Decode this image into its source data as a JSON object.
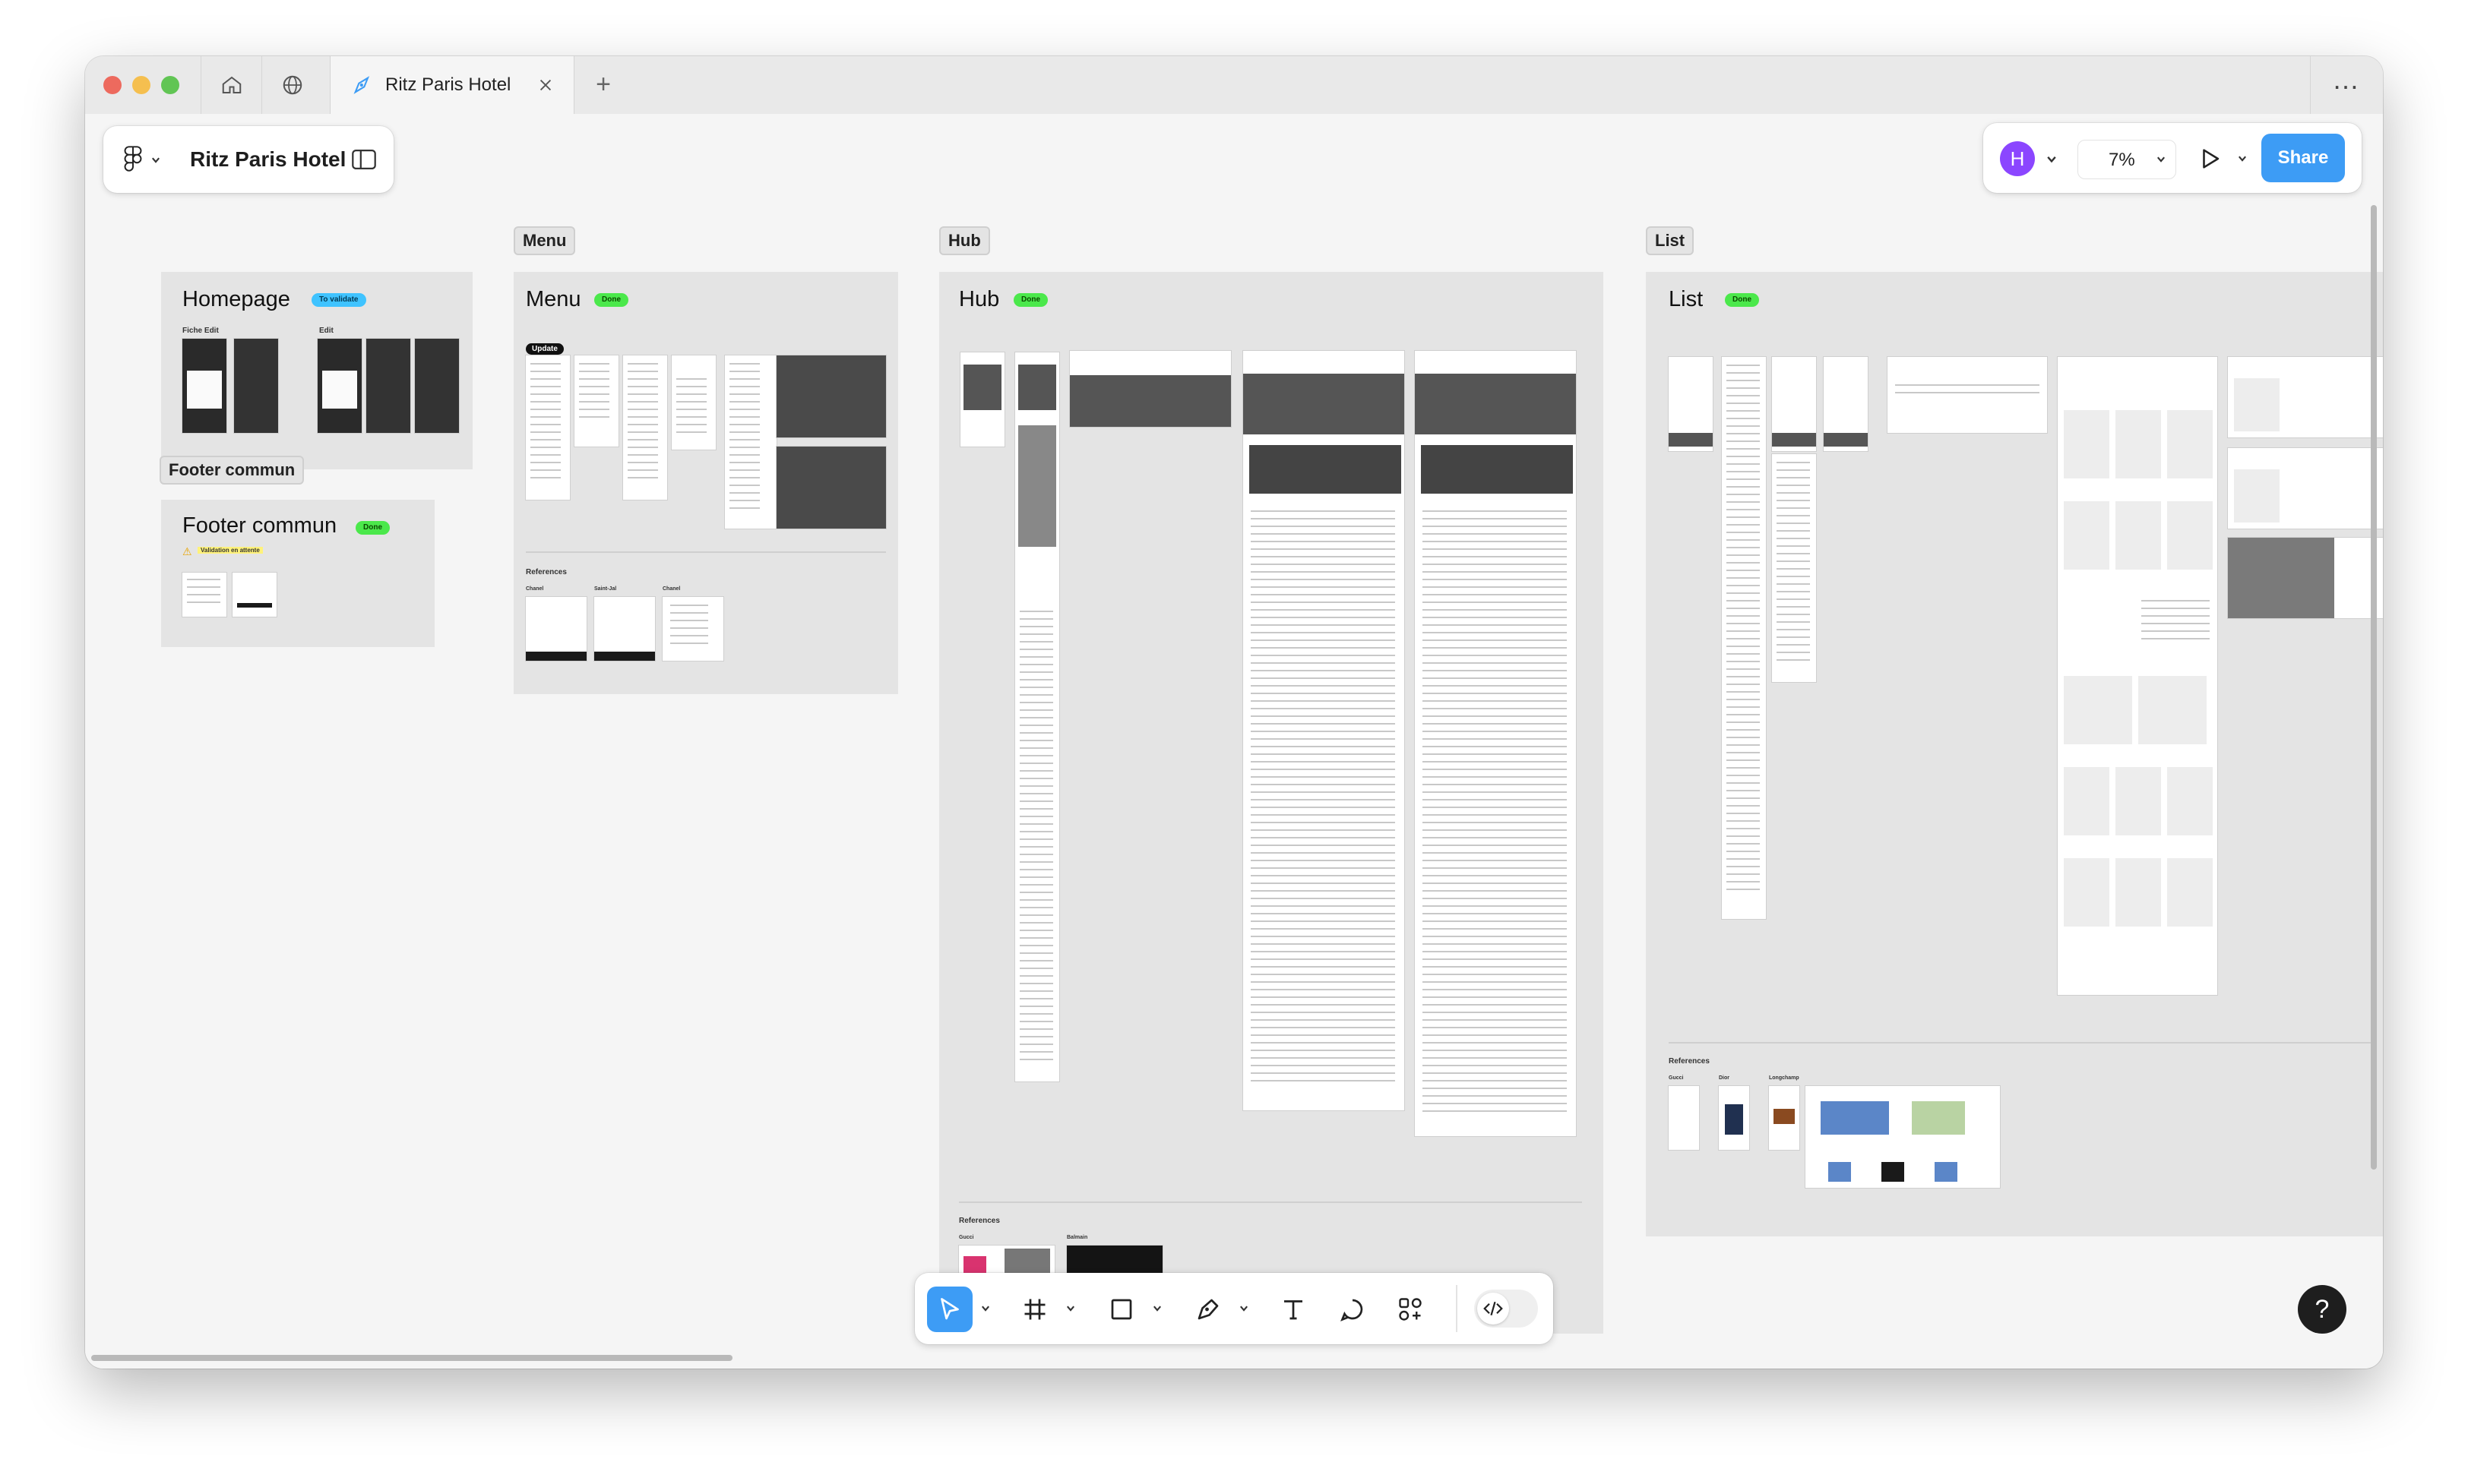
{
  "browser": {
    "tab_title": "Ritz Paris Hotel",
    "new_tab_label": "+",
    "more_label": "…"
  },
  "file": {
    "name": "Ritz Paris Hotel"
  },
  "header": {
    "avatar_initial": "H",
    "avatar_color": "#8b46ff",
    "zoom": "7%",
    "share_label": "Share",
    "accent": "#3d9cf5"
  },
  "sections": {
    "homepage": {
      "title": "Homepage",
      "badge": "To validate",
      "sub_a": "Fiche Edit",
      "sub_b": "Edit"
    },
    "footer": {
      "label": "Footer commun",
      "title": "Footer commun",
      "badge": "Done",
      "warning": "Validation en attente"
    },
    "menu": {
      "label": "Menu",
      "title": "Menu",
      "badge": "Done",
      "update_tag": "Update",
      "references": "References",
      "ref_a": "Chanel",
      "ref_b": "Saint-Jal",
      "ref_c": "Chanel"
    },
    "hub": {
      "label": "Hub",
      "title": "Hub",
      "badge": "Done",
      "references": "References",
      "ref_a": "Gucci",
      "ref_b": "Balmain"
    },
    "list": {
      "label": "List",
      "title": "List",
      "badge": "Done",
      "references": "References",
      "ref_a": "Gucci",
      "ref_b": "Dior",
      "ref_c": "Longchamp"
    }
  },
  "toolbar": {
    "tools": [
      "move-tool",
      "frame-tool",
      "shape-tool",
      "pen-tool",
      "text-tool",
      "comment-tool",
      "actions-tool",
      "dev-mode-toggle"
    ]
  },
  "help_label": "?"
}
